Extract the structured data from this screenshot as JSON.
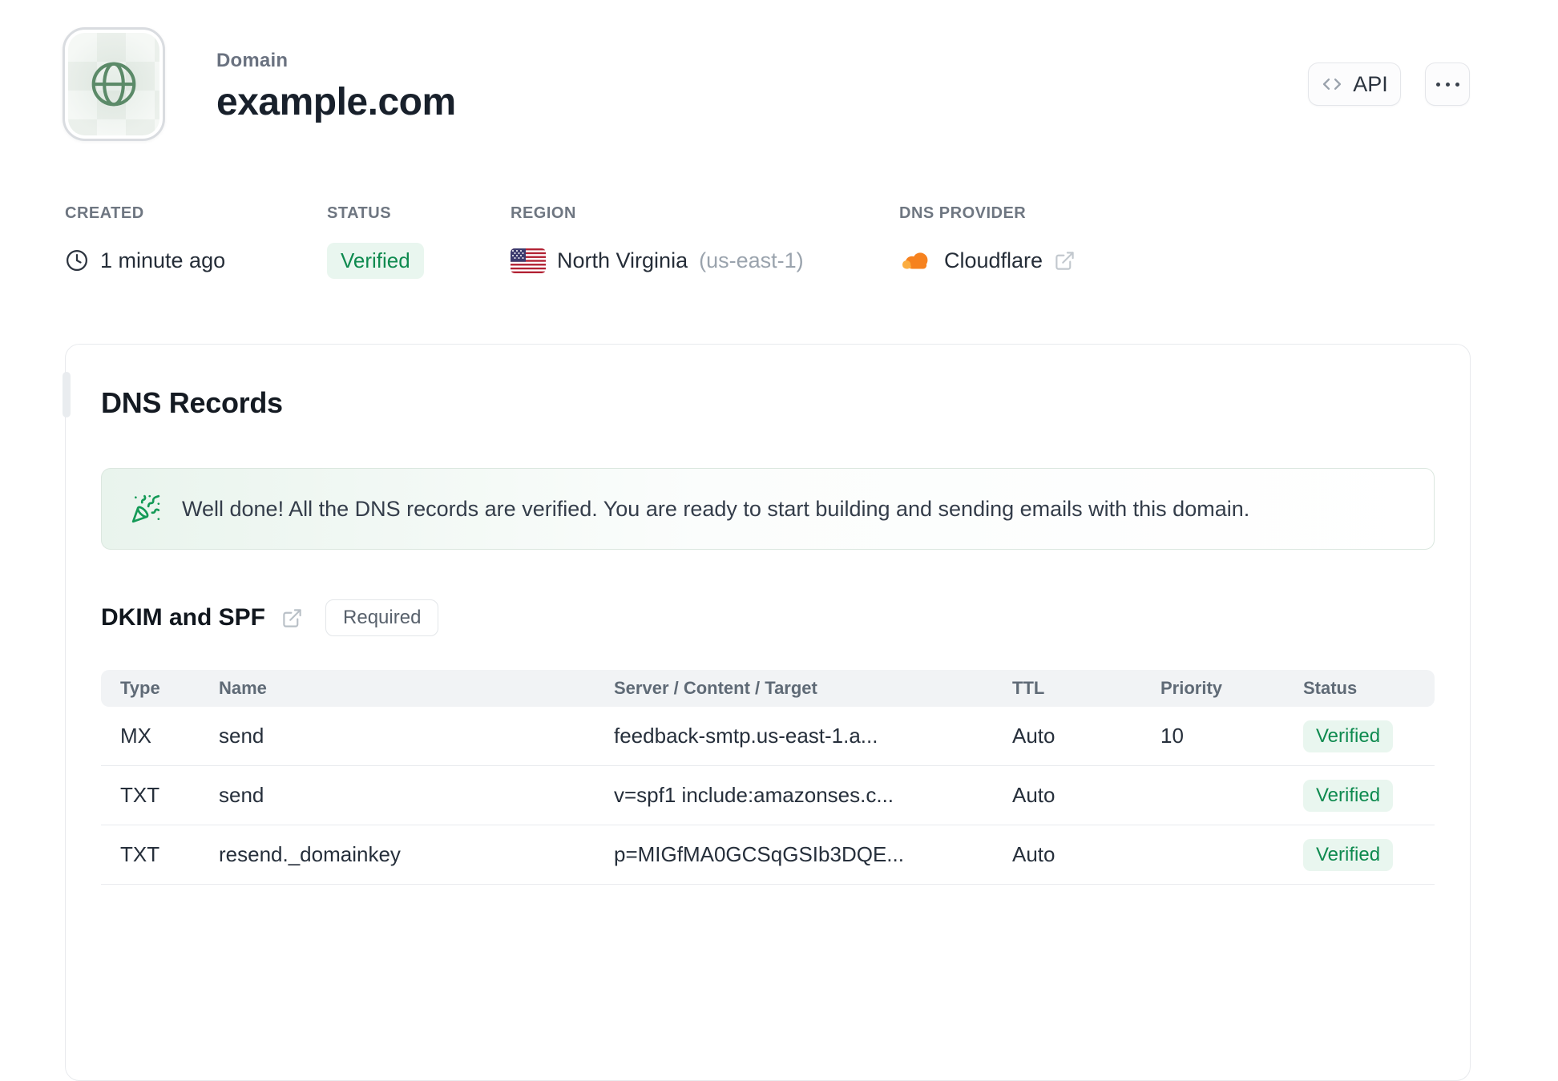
{
  "header": {
    "eyebrow": "Domain",
    "title": "example.com",
    "api_button_label": "API"
  },
  "meta": {
    "created": {
      "label": "CREATED",
      "value": "1 minute ago"
    },
    "status": {
      "label": "STATUS",
      "value": "Verified"
    },
    "region": {
      "label": "REGION",
      "value": "North Virginia",
      "code": "(us-east-1)"
    },
    "dns_provider": {
      "label": "DNS PROVIDER",
      "value": "Cloudflare"
    }
  },
  "dns_card": {
    "title": "DNS Records",
    "callout": "Well done! All the DNS records are verified. You are ready to start building and sending emails with this domain.",
    "section": {
      "title": "DKIM and SPF",
      "badge": "Required"
    },
    "table": {
      "headers": [
        "Type",
        "Name",
        "Server / Content / Target",
        "TTL",
        "Priority",
        "Status"
      ],
      "rows": [
        {
          "type": "MX",
          "name": "send",
          "content": "feedback-smtp.us-east-1.a...",
          "ttl": "Auto",
          "priority": "10",
          "status": "Verified"
        },
        {
          "type": "TXT",
          "name": "send",
          "content": "v=spf1 include:amazonses.c...",
          "ttl": "Auto",
          "priority": "",
          "status": "Verified"
        },
        {
          "type": "TXT",
          "name": "resend._domainkey",
          "content": "p=MIGfMA0GCSqGSIb3DQE...",
          "ttl": "Auto",
          "priority": "",
          "status": "Verified"
        }
      ]
    }
  },
  "colors": {
    "accent_green": "#0e8a4f",
    "badge_green_bg": "#e9f6ef",
    "cloudflare_orange": "#f6821f",
    "cloudflare_orange_light": "#fbad41"
  }
}
